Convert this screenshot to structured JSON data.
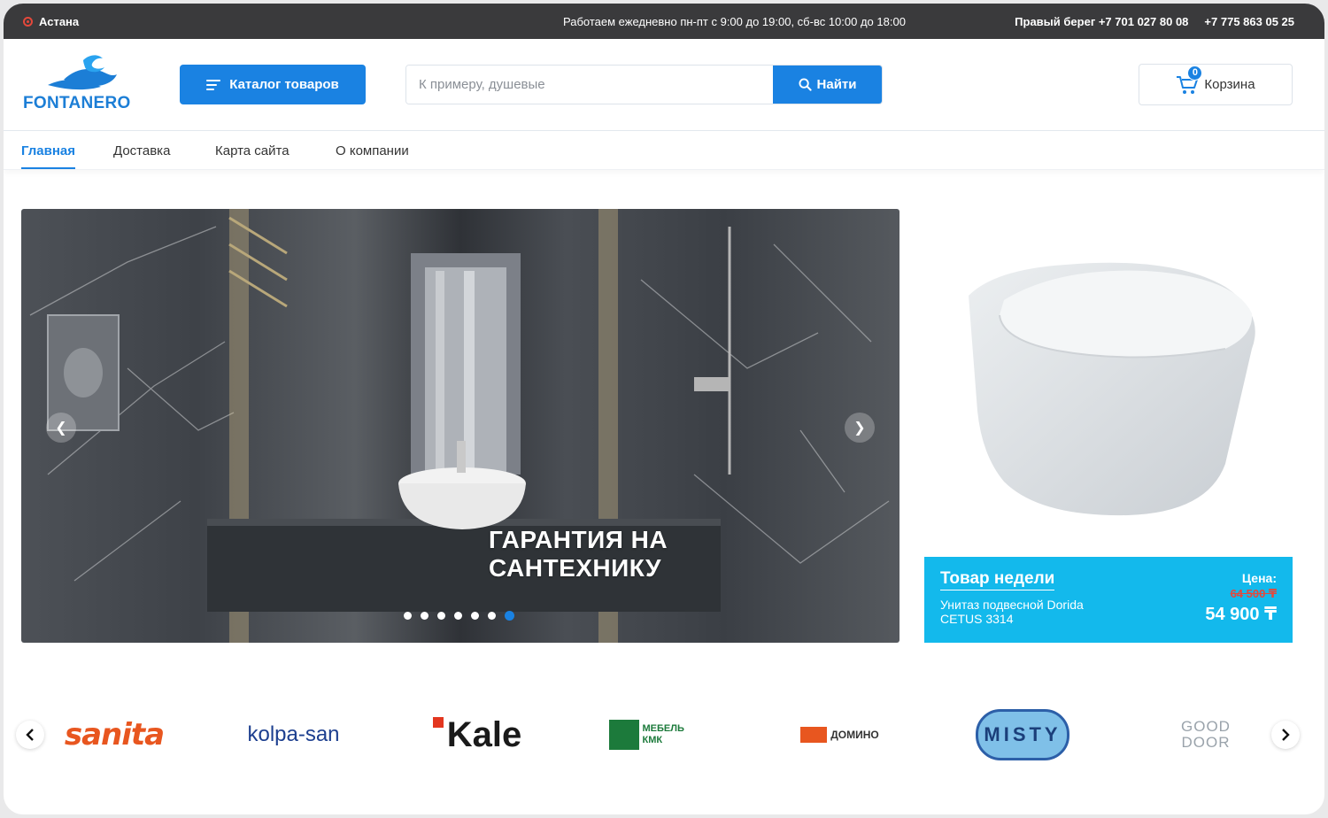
{
  "topbar": {
    "city": "Астана",
    "hours": "Работаем ежедневно пн-пт с 9:00 до 19:00, сб-вс 10:00 до 18:00",
    "phone1": "Правый берег +7 701 027 80 08",
    "phone2": "+7 775 863 05 25"
  },
  "header": {
    "logo_text": "FONTANERO",
    "catalog_label": "Каталог товаров",
    "search_placeholder": "К примеру, душевые",
    "search_button": "Найти",
    "cart_label": "Корзина",
    "cart_count": "0"
  },
  "nav": {
    "items": [
      {
        "label": "Главная",
        "active": true
      },
      {
        "label": "Доставка",
        "active": false
      },
      {
        "label": "Карта сайта",
        "active": false
      },
      {
        "label": "О компании",
        "active": false
      }
    ]
  },
  "hero": {
    "title": "ГАРАНТИЯ НА САНТЕХНИКУ",
    "slide_count": 7,
    "active_slide": 7
  },
  "product_of_week": {
    "label": "Товар недели",
    "name": "Унитаз подвесной Dorida CETUS 3314",
    "price_label": "Цена:",
    "old_price": "64 500 ₸",
    "new_price": "54 900 ₸"
  },
  "brands": {
    "items": [
      "sanita",
      "kolpa-san",
      "Kale",
      "МЕБЕЛЬ КМК",
      "ДОМИНО",
      "MISTY",
      "GOOD DOOR"
    ]
  },
  "colors": {
    "accent": "#1a82e2",
    "topbar_bg": "#3a3a3c",
    "promo_bg": "#13b9ec",
    "old_price": "#e4483b"
  }
}
